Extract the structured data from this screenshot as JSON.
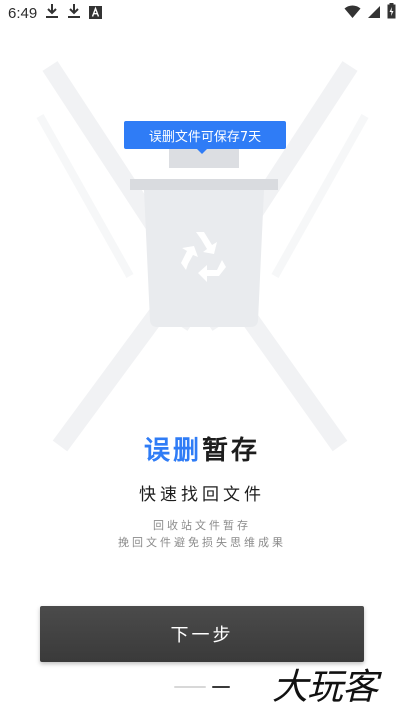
{
  "status_bar": {
    "time": "6:49",
    "icons_left": [
      "download-icon",
      "download-icon",
      "font-a-icon"
    ],
    "icons_right": [
      "wifi-icon",
      "signal-icon",
      "battery-charging-icon"
    ]
  },
  "illustration": {
    "bubble_text": "误删文件可保存7天",
    "icon": "recycle-icon"
  },
  "onboarding": {
    "title_highlight": "误删",
    "title_rest": "暂存",
    "subtitle": "快速找回文件",
    "description_line1": "回收站文件暂存",
    "description_line2": "挽回文件避免损失思维成果"
  },
  "next_button_label": "下一步",
  "page_indicator": {
    "total": 2,
    "active": 2
  },
  "watermark_text": "大玩客",
  "colors": {
    "accent": "#2f7cf6",
    "button": "#404040"
  }
}
